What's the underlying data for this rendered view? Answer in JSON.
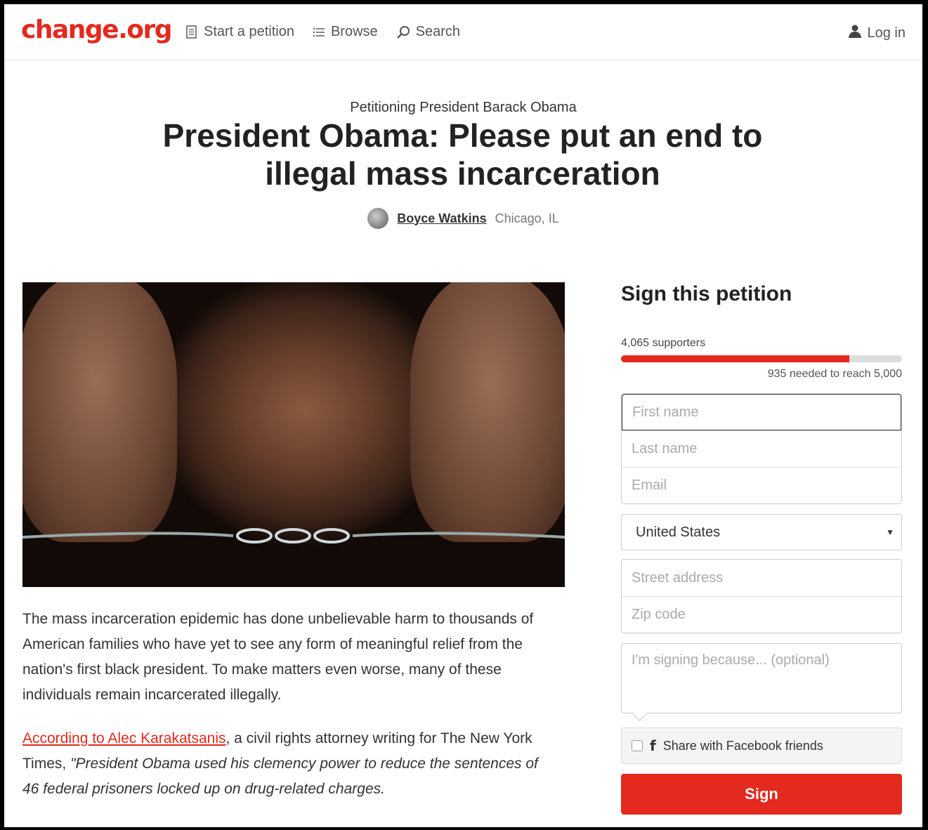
{
  "header": {
    "logo": "change.org",
    "nav": [
      {
        "label": "Start a petition",
        "icon": "document-icon"
      },
      {
        "label": "Browse",
        "icon": "list-icon"
      },
      {
        "label": "Search",
        "icon": "search-icon"
      }
    ],
    "login": {
      "label": "Log in",
      "icon": "user-icon"
    }
  },
  "petition": {
    "petitioning": "Petitioning President Barack Obama",
    "title": "President Obama: Please put an end to illegal mass incarceration",
    "author": "Boyce Watkins",
    "location": "Chicago, IL"
  },
  "body": {
    "p1": "The mass incarceration epidemic has done unbelievable harm to thousands of American families who have yet to see any form of meaningful relief from the nation's first black president.   To make matters even worse, many of these individuals remain incarcerated illegally.",
    "p2_link": "According to Alec Karakatsanis",
    "p2_text": ", a civil rights attorney writing for The New York Times, ",
    "p2_quote": "\"President Obama used his clemency power to reduce the sentences of 46 federal prisoners locked up on drug-related charges."
  },
  "sidebar": {
    "heading": "Sign this petition",
    "supporters": "4,065 supporters",
    "progress_fraction": 0.813,
    "needed": "935 needed to reach 5,000",
    "placeholders": {
      "first_name": "First name",
      "last_name": "Last name",
      "email": "Email",
      "street": "Street address",
      "zip": "Zip code"
    },
    "country": "United States",
    "reason_placeholder": "I'm signing because... (optional)",
    "facebook_share": "Share with Facebook friends",
    "sign_button": "Sign"
  },
  "colors": {
    "brand": "#e4291f"
  }
}
